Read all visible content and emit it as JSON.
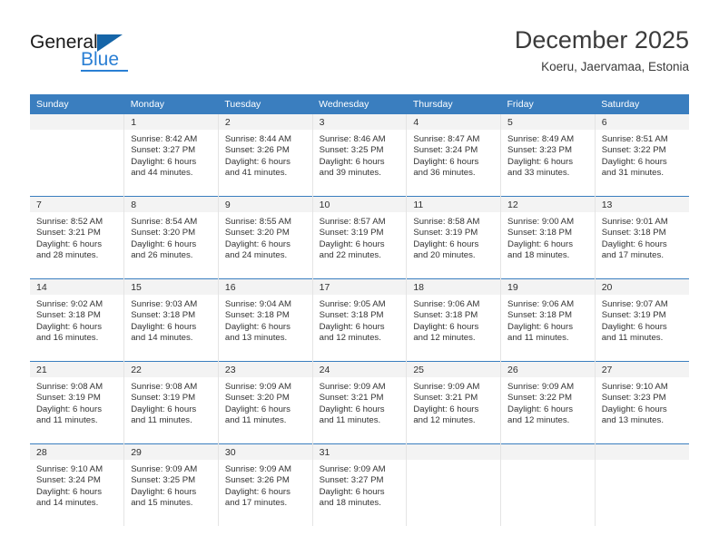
{
  "brand": {
    "name_top": "General",
    "name_bottom": "Blue",
    "accent_color": "#2a7fd4",
    "triangle_color": "#1565a8"
  },
  "header": {
    "title": "December 2025",
    "subtitle": "Koeru, Jaervamaa, Estonia"
  },
  "theme": {
    "header_bg": "#3a7ebf",
    "header_text": "#ffffff",
    "daynum_strip_bg": "#f3f3f3",
    "cell_border": "#e4e4e4",
    "row_divider": "#3a7ebf"
  },
  "weekdays": [
    "Sunday",
    "Monday",
    "Tuesday",
    "Wednesday",
    "Thursday",
    "Friday",
    "Saturday"
  ],
  "weeks": [
    [
      {
        "day": "",
        "sunrise": "",
        "sunset": "",
        "daylight_1": "",
        "daylight_2": ""
      },
      {
        "day": "1",
        "sunrise": "Sunrise: 8:42 AM",
        "sunset": "Sunset: 3:27 PM",
        "daylight_1": "Daylight: 6 hours",
        "daylight_2": "and 44 minutes."
      },
      {
        "day": "2",
        "sunrise": "Sunrise: 8:44 AM",
        "sunset": "Sunset: 3:26 PM",
        "daylight_1": "Daylight: 6 hours",
        "daylight_2": "and 41 minutes."
      },
      {
        "day": "3",
        "sunrise": "Sunrise: 8:46 AM",
        "sunset": "Sunset: 3:25 PM",
        "daylight_1": "Daylight: 6 hours",
        "daylight_2": "and 39 minutes."
      },
      {
        "day": "4",
        "sunrise": "Sunrise: 8:47 AM",
        "sunset": "Sunset: 3:24 PM",
        "daylight_1": "Daylight: 6 hours",
        "daylight_2": "and 36 minutes."
      },
      {
        "day": "5",
        "sunrise": "Sunrise: 8:49 AM",
        "sunset": "Sunset: 3:23 PM",
        "daylight_1": "Daylight: 6 hours",
        "daylight_2": "and 33 minutes."
      },
      {
        "day": "6",
        "sunrise": "Sunrise: 8:51 AM",
        "sunset": "Sunset: 3:22 PM",
        "daylight_1": "Daylight: 6 hours",
        "daylight_2": "and 31 minutes."
      }
    ],
    [
      {
        "day": "7",
        "sunrise": "Sunrise: 8:52 AM",
        "sunset": "Sunset: 3:21 PM",
        "daylight_1": "Daylight: 6 hours",
        "daylight_2": "and 28 minutes."
      },
      {
        "day": "8",
        "sunrise": "Sunrise: 8:54 AM",
        "sunset": "Sunset: 3:20 PM",
        "daylight_1": "Daylight: 6 hours",
        "daylight_2": "and 26 minutes."
      },
      {
        "day": "9",
        "sunrise": "Sunrise: 8:55 AM",
        "sunset": "Sunset: 3:20 PM",
        "daylight_1": "Daylight: 6 hours",
        "daylight_2": "and 24 minutes."
      },
      {
        "day": "10",
        "sunrise": "Sunrise: 8:57 AM",
        "sunset": "Sunset: 3:19 PM",
        "daylight_1": "Daylight: 6 hours",
        "daylight_2": "and 22 minutes."
      },
      {
        "day": "11",
        "sunrise": "Sunrise: 8:58 AM",
        "sunset": "Sunset: 3:19 PM",
        "daylight_1": "Daylight: 6 hours",
        "daylight_2": "and 20 minutes."
      },
      {
        "day": "12",
        "sunrise": "Sunrise: 9:00 AM",
        "sunset": "Sunset: 3:18 PM",
        "daylight_1": "Daylight: 6 hours",
        "daylight_2": "and 18 minutes."
      },
      {
        "day": "13",
        "sunrise": "Sunrise: 9:01 AM",
        "sunset": "Sunset: 3:18 PM",
        "daylight_1": "Daylight: 6 hours",
        "daylight_2": "and 17 minutes."
      }
    ],
    [
      {
        "day": "14",
        "sunrise": "Sunrise: 9:02 AM",
        "sunset": "Sunset: 3:18 PM",
        "daylight_1": "Daylight: 6 hours",
        "daylight_2": "and 16 minutes."
      },
      {
        "day": "15",
        "sunrise": "Sunrise: 9:03 AM",
        "sunset": "Sunset: 3:18 PM",
        "daylight_1": "Daylight: 6 hours",
        "daylight_2": "and 14 minutes."
      },
      {
        "day": "16",
        "sunrise": "Sunrise: 9:04 AM",
        "sunset": "Sunset: 3:18 PM",
        "daylight_1": "Daylight: 6 hours",
        "daylight_2": "and 13 minutes."
      },
      {
        "day": "17",
        "sunrise": "Sunrise: 9:05 AM",
        "sunset": "Sunset: 3:18 PM",
        "daylight_1": "Daylight: 6 hours",
        "daylight_2": "and 12 minutes."
      },
      {
        "day": "18",
        "sunrise": "Sunrise: 9:06 AM",
        "sunset": "Sunset: 3:18 PM",
        "daylight_1": "Daylight: 6 hours",
        "daylight_2": "and 12 minutes."
      },
      {
        "day": "19",
        "sunrise": "Sunrise: 9:06 AM",
        "sunset": "Sunset: 3:18 PM",
        "daylight_1": "Daylight: 6 hours",
        "daylight_2": "and 11 minutes."
      },
      {
        "day": "20",
        "sunrise": "Sunrise: 9:07 AM",
        "sunset": "Sunset: 3:19 PM",
        "daylight_1": "Daylight: 6 hours",
        "daylight_2": "and 11 minutes."
      }
    ],
    [
      {
        "day": "21",
        "sunrise": "Sunrise: 9:08 AM",
        "sunset": "Sunset: 3:19 PM",
        "daylight_1": "Daylight: 6 hours",
        "daylight_2": "and 11 minutes."
      },
      {
        "day": "22",
        "sunrise": "Sunrise: 9:08 AM",
        "sunset": "Sunset: 3:19 PM",
        "daylight_1": "Daylight: 6 hours",
        "daylight_2": "and 11 minutes."
      },
      {
        "day": "23",
        "sunrise": "Sunrise: 9:09 AM",
        "sunset": "Sunset: 3:20 PM",
        "daylight_1": "Daylight: 6 hours",
        "daylight_2": "and 11 minutes."
      },
      {
        "day": "24",
        "sunrise": "Sunrise: 9:09 AM",
        "sunset": "Sunset: 3:21 PM",
        "daylight_1": "Daylight: 6 hours",
        "daylight_2": "and 11 minutes."
      },
      {
        "day": "25",
        "sunrise": "Sunrise: 9:09 AM",
        "sunset": "Sunset: 3:21 PM",
        "daylight_1": "Daylight: 6 hours",
        "daylight_2": "and 12 minutes."
      },
      {
        "day": "26",
        "sunrise": "Sunrise: 9:09 AM",
        "sunset": "Sunset: 3:22 PM",
        "daylight_1": "Daylight: 6 hours",
        "daylight_2": "and 12 minutes."
      },
      {
        "day": "27",
        "sunrise": "Sunrise: 9:10 AM",
        "sunset": "Sunset: 3:23 PM",
        "daylight_1": "Daylight: 6 hours",
        "daylight_2": "and 13 minutes."
      }
    ],
    [
      {
        "day": "28",
        "sunrise": "Sunrise: 9:10 AM",
        "sunset": "Sunset: 3:24 PM",
        "daylight_1": "Daylight: 6 hours",
        "daylight_2": "and 14 minutes."
      },
      {
        "day": "29",
        "sunrise": "Sunrise: 9:09 AM",
        "sunset": "Sunset: 3:25 PM",
        "daylight_1": "Daylight: 6 hours",
        "daylight_2": "and 15 minutes."
      },
      {
        "day": "30",
        "sunrise": "Sunrise: 9:09 AM",
        "sunset": "Sunset: 3:26 PM",
        "daylight_1": "Daylight: 6 hours",
        "daylight_2": "and 17 minutes."
      },
      {
        "day": "31",
        "sunrise": "Sunrise: 9:09 AM",
        "sunset": "Sunset: 3:27 PM",
        "daylight_1": "Daylight: 6 hours",
        "daylight_2": "and 18 minutes."
      },
      {
        "day": "",
        "sunrise": "",
        "sunset": "",
        "daylight_1": "",
        "daylight_2": ""
      },
      {
        "day": "",
        "sunrise": "",
        "sunset": "",
        "daylight_1": "",
        "daylight_2": ""
      },
      {
        "day": "",
        "sunrise": "",
        "sunset": "",
        "daylight_1": "",
        "daylight_2": ""
      }
    ]
  ]
}
